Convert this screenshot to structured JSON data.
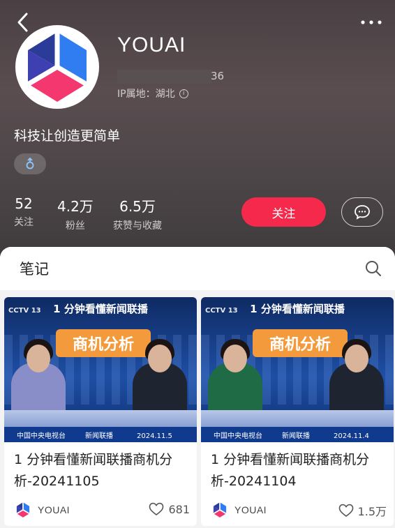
{
  "profile": {
    "name": "YOUAI",
    "id_suffix": "36",
    "ip_label": "IP属地：湖北",
    "info_icon": "ⓘ",
    "bio": "科技让创造更简单",
    "tag_icon": "gender-male-icon"
  },
  "stats": [
    {
      "value": "52",
      "label": "关注"
    },
    {
      "value": "4.2万",
      "label": "粉丝"
    },
    {
      "value": "6.5万",
      "label": "获赞与收藏"
    }
  ],
  "actions": {
    "follow_label": "关注",
    "message_icon": "chat-bubble-icon"
  },
  "notes_section": {
    "title": "笔记"
  },
  "notes": [
    {
      "banner": "1 分钟看懂新闻联播",
      "topic": "商机分析",
      "logo": "CCTV 13",
      "lower_left": "中国中央电视台",
      "lower_mid": "新闻联播",
      "date": "2024.11.5",
      "title": "1 分钟看懂新闻联播商机分析-20241105",
      "author": "YOUAI",
      "likes": "681"
    },
    {
      "banner": "1 分钟看懂新闻联播",
      "topic": "商机分析",
      "logo": "CCTV 13",
      "lower_left": "中国中央电视台",
      "lower_mid": "新闻联播",
      "date": "2024.11.4",
      "title": "1 分钟看懂新闻联播商机分析-20241104",
      "author": "YOUAI",
      "likes": "1.5万"
    }
  ],
  "colors": {
    "accent": "#f5294c",
    "header_bg": "#4f4548",
    "topic_badge": "#f39a3d"
  }
}
